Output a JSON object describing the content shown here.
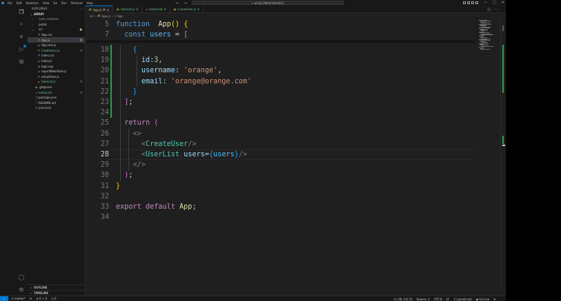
{
  "titlebar": {
    "menu": [
      "File",
      "Edit",
      "Selection",
      "View",
      "Go",
      "Run",
      "Terminal",
      "Help"
    ],
    "search": "⌕ array [Administrator]",
    "back_arrow": "←",
    "forward_arrow": "→",
    "minimize": "—",
    "maximize": "□",
    "close": "✕"
  },
  "activity": [
    "explorer-icon",
    "search-icon",
    "source-control-icon",
    "run-debug-icon",
    "extensions-icon",
    "account-icon",
    "settings-gear-icon"
  ],
  "explorer": {
    "header": "EXPLORER",
    "more": "···",
    "folder": "ARRAY",
    "items": [
      {
        "chev": "›",
        "icon": "",
        "name": "node_modules",
        "color": "#9d9d9d",
        "indent": 6,
        "badge": ""
      },
      {
        "chev": "›",
        "icon": "",
        "name": "public",
        "color": "#cccccc",
        "indent": 6,
        "badge": ""
      },
      {
        "chev": "⌄",
        "icon": "",
        "name": "src",
        "color": "#e2c08d",
        "indent": 6,
        "badge": "●"
      },
      {
        "chev": "",
        "icon": "#",
        "name": "App.css",
        "color": "#cccccc",
        "indent": 10,
        "badge": ""
      },
      {
        "chev": "",
        "icon": "JS",
        "name": "App.js",
        "color": "#e2c08d",
        "indent": 10,
        "badge": "M",
        "selected": true
      },
      {
        "chev": "",
        "icon": "JS",
        "name": "App.test.js",
        "color": "#cccccc",
        "indent": 10,
        "badge": ""
      },
      {
        "chev": "",
        "icon": "JS",
        "name": "CreateUser.js",
        "color": "#73c991",
        "indent": 10,
        "badge": "U"
      },
      {
        "chev": "",
        "icon": "#",
        "name": "index.css",
        "color": "#cccccc",
        "indent": 10,
        "badge": ""
      },
      {
        "chev": "",
        "icon": "JS",
        "name": "index.js",
        "color": "#cccccc",
        "indent": 10,
        "badge": ""
      },
      {
        "chev": "",
        "icon": "◈",
        "name": "logo.svg",
        "color": "#cccccc",
        "indent": 10,
        "badge": ""
      },
      {
        "chev": "",
        "icon": "JS",
        "name": "reportWebVitals.js",
        "color": "#cccccc",
        "indent": 10,
        "badge": ""
      },
      {
        "chev": "",
        "icon": "JS",
        "name": "setupTests.js",
        "color": "#cccccc",
        "indent": 10,
        "badge": ""
      },
      {
        "chev": "",
        "icon": "JS",
        "name": "UserList.js",
        "color": "#73c991",
        "indent": 10,
        "badge": "U"
      },
      {
        "chev": "",
        "icon": "◆",
        "name": ".gitignore",
        "color": "#cccccc",
        "indent": 6,
        "badge": ""
      },
      {
        "chev": "",
        "icon": "≡",
        "name": "memo.txt",
        "color": "#73c991",
        "indent": 6,
        "badge": "U"
      },
      {
        "chev": "",
        "icon": "{}",
        "name": "package.json",
        "color": "#cccccc",
        "indent": 6,
        "badge": ""
      },
      {
        "chev": "",
        "icon": "ⓘ",
        "name": "README.md",
        "color": "#cccccc",
        "indent": 6,
        "badge": ""
      },
      {
        "chev": "",
        "icon": "☰",
        "name": "yarn.lock",
        "color": "#cccccc",
        "indent": 6,
        "badge": ""
      }
    ],
    "outline": "OUTLINE",
    "timeline": "TIMELINE"
  },
  "tabs": [
    {
      "icon": "JS",
      "name": "App.js",
      "status": "M",
      "close": "✕",
      "active": true,
      "color": "#e2c08d"
    },
    {
      "icon": "JS",
      "name": "UserList.js",
      "status": "U",
      "close": "",
      "active": false,
      "color": "#73c991"
    },
    {
      "icon": "≡",
      "name": "memo.txt",
      "status": "U",
      "close": "",
      "active": false,
      "color": "#73c991"
    },
    {
      "icon": "JS",
      "name": "CreateUser.js",
      "status": "U",
      "close": "",
      "active": false,
      "color": "#73c991"
    }
  ],
  "breadcrumb": {
    "folder": "src",
    "sep": "›",
    "jsicon": "JS",
    "file": "App.js",
    "sep2": "›",
    "symbol": "⬡ App"
  },
  "editor": {
    "sticky_lines": [
      {
        "n": "5",
        "tokens": [
          [
            "kw",
            "function"
          ],
          [
            "",
            "  "
          ],
          [
            "fn",
            "App"
          ],
          [
            "br1",
            "()"
          ],
          [
            "",
            " "
          ],
          [
            "br1",
            "{"
          ]
        ]
      },
      {
        "n": "7",
        "tokens": [
          [
            "",
            "  "
          ],
          [
            "kw",
            "const"
          ],
          [
            "",
            " "
          ],
          [
            "cst",
            "users"
          ],
          [
            "",
            " = "
          ],
          [
            "br2",
            "["
          ]
        ]
      }
    ],
    "lines": [
      {
        "n": "18",
        "tokens": [
          [
            "",
            "    "
          ],
          [
            "br3",
            "{"
          ]
        ]
      },
      {
        "n": "19",
        "tokens": [
          [
            "",
            "      "
          ],
          [
            "var",
            "id"
          ],
          [
            "",
            ":"
          ],
          [
            "num",
            "3"
          ],
          [
            "",
            ","
          ]
        ]
      },
      {
        "n": "20",
        "tokens": [
          [
            "",
            "      "
          ],
          [
            "var",
            "username"
          ],
          [
            "",
            ": "
          ],
          [
            "str",
            "'orange'"
          ],
          [
            "",
            ","
          ]
        ]
      },
      {
        "n": "21",
        "tokens": [
          [
            "",
            "      "
          ],
          [
            "var",
            "email"
          ],
          [
            "",
            ": "
          ],
          [
            "str",
            "'orange@orange.com'"
          ]
        ]
      },
      {
        "n": "22",
        "tokens": [
          [
            "",
            "    "
          ],
          [
            "br3",
            "}"
          ]
        ]
      },
      {
        "n": "23",
        "tokens": [
          [
            "",
            "  "
          ],
          [
            "br2",
            "]"
          ],
          [
            "",
            ";"
          ]
        ]
      },
      {
        "n": "24",
        "tokens": []
      },
      {
        "n": "25",
        "tokens": [
          [
            "",
            "  "
          ],
          [
            "ctl",
            "return"
          ],
          [
            "",
            " "
          ],
          [
            "br2",
            "("
          ]
        ]
      },
      {
        "n": "26",
        "tokens": [
          [
            "",
            "    "
          ],
          [
            "ang",
            "<>"
          ]
        ]
      },
      {
        "n": "27",
        "tokens": [
          [
            "",
            "      "
          ],
          [
            "ang",
            "<"
          ],
          [
            "tag",
            "CreateUser"
          ],
          [
            "ang",
            "/>"
          ]
        ]
      },
      {
        "n": "28",
        "tokens": [
          [
            "",
            "      "
          ],
          [
            "ang",
            "<"
          ],
          [
            "tag",
            "UserList"
          ],
          [
            "",
            " "
          ],
          [
            "var",
            "users"
          ],
          [
            "",
            "="
          ],
          [
            "br3",
            "{"
          ],
          [
            "cst",
            "users"
          ],
          [
            "br3",
            "}"
          ],
          [
            "ang",
            "/>"
          ]
        ],
        "current": true
      },
      {
        "n": "29",
        "tokens": [
          [
            "",
            "    "
          ],
          [
            "ang",
            "</>"
          ]
        ]
      },
      {
        "n": "30",
        "tokens": [
          [
            "",
            "  "
          ],
          [
            "br2",
            ")"
          ],
          [
            "",
            ";"
          ]
        ]
      },
      {
        "n": "31",
        "tokens": [
          [
            "br1",
            "}"
          ]
        ]
      },
      {
        "n": "32",
        "tokens": []
      },
      {
        "n": "33",
        "tokens": [
          [
            "ctl",
            "export"
          ],
          [
            "",
            " "
          ],
          [
            "ctl",
            "default"
          ],
          [
            "",
            " "
          ],
          [
            "fn",
            "App"
          ],
          [
            "",
            ";"
          ]
        ]
      },
      {
        "n": "34",
        "tokens": []
      }
    ]
  },
  "statusbar": {
    "remote": "⌁",
    "branch": "⎇ master*",
    "sync": "⟳",
    "problems": "⊗ 0 ⚠ 0",
    "ports": "◎ 0",
    "position": "Ln 28, Col 22",
    "spaces": "Spaces: 2",
    "encoding": "UTF-8",
    "eol": "LF",
    "language": "{} JavaScript",
    "golive": "◉ Go Live",
    "bell": "⍾"
  },
  "colors": {
    "accent": "#0078d4",
    "modified": "#e2c08d",
    "untracked": "#73c991",
    "git_added": "#2ea043"
  }
}
